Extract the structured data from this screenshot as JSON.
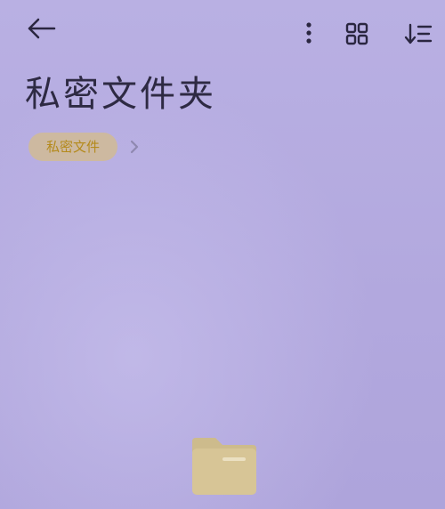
{
  "header": {
    "back_icon": "back-arrow-icon",
    "more_icon": "more-vertical-icon",
    "grid_icon": "grid-view-icon",
    "sort_icon": "sort-icon"
  },
  "page": {
    "title": "私密文件夹"
  },
  "breadcrumb": {
    "items": [
      {
        "label": "私密文件"
      }
    ],
    "chevron_icon": "chevron-right-icon"
  },
  "empty_state": {
    "icon": "folder-icon"
  },
  "colors": {
    "background": "#b5abe0",
    "chip_background": "#cdb9a0",
    "chip_text": "#b48a1c",
    "folder": "#d7c596"
  }
}
